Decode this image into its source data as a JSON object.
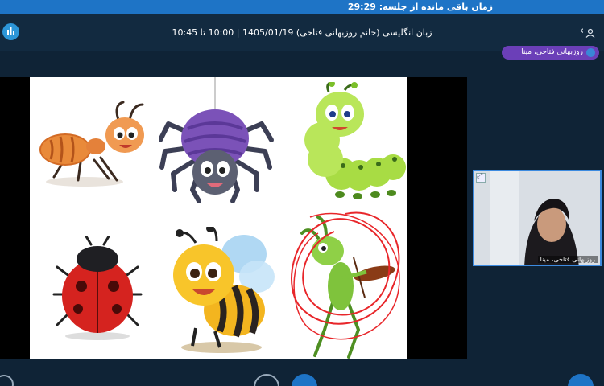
{
  "timer": {
    "label": "زمان باقی مانده از جلسه: 29:29"
  },
  "session": {
    "title": "زبان انگلیسی (خانم روزبهانی فتاحی) 1405/01/19 | 10:00 تا 10:45"
  },
  "icons": {
    "stats": "bar-chart-icon",
    "back": "chevron-left-icon",
    "user": "user-icon",
    "speaker": "microphone-icon",
    "expand": "expand-icon",
    "left_button": "settings-icon",
    "camera": "camera-off-icon",
    "share": "screen-share-icon",
    "plus": "plus-icon"
  },
  "speaker": {
    "name": "روزبهانی فتاحی، مینا"
  },
  "slide": {
    "items": [
      "ant",
      "spider",
      "caterpillar",
      "ladybug",
      "bee",
      "grasshopper"
    ]
  },
  "video": {
    "name": "روزبهانی فتاحی، مینا"
  },
  "colors": {
    "accent": "#1e74c6",
    "speaker_pill": "#6b3fb8",
    "annotation": "#e8262a"
  }
}
